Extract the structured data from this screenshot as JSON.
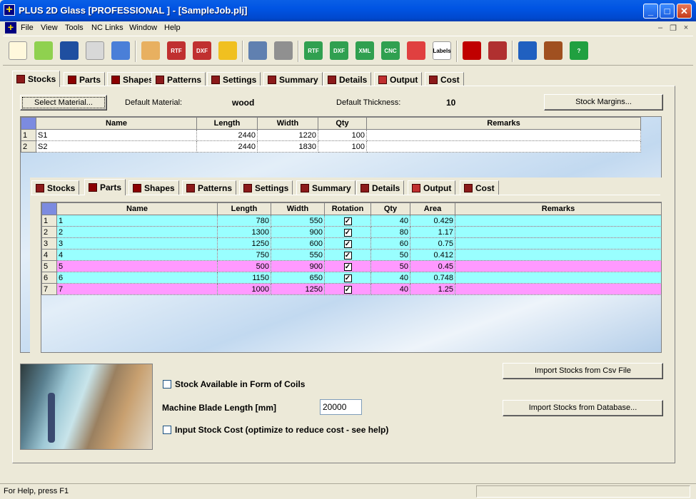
{
  "window": {
    "title": "PLUS 2D Glass [PROFESSIONAL ] - [SampleJob.plj]"
  },
  "menu": [
    "File",
    "View",
    "Tools",
    "NC Links",
    "Window",
    "Help"
  ],
  "toolbar": {
    "buttons": [
      {
        "name": "new-job-icon",
        "label": ""
      },
      {
        "name": "open-job-icon",
        "label": ""
      },
      {
        "name": "save-job-icon",
        "label": ""
      },
      {
        "name": "lock-icon",
        "label": ""
      },
      {
        "name": "checklist-icon",
        "label": ""
      },
      {
        "name": "palette-icon",
        "label": ""
      },
      {
        "name": "rtf-icon",
        "label": "RTF"
      },
      {
        "name": "dxf-icon",
        "label": "DXF"
      },
      {
        "name": "star-icon",
        "label": ""
      },
      {
        "name": "optimize-gear-icon",
        "label": ""
      },
      {
        "name": "refresh-icon",
        "label": ""
      },
      {
        "name": "rtf-export-icon",
        "label": "RTF"
      },
      {
        "name": "dxf-export-icon",
        "label": "DXF"
      },
      {
        "name": "xml-export-icon",
        "label": "XML"
      },
      {
        "name": "cnc-export-icon",
        "label": "CNC"
      },
      {
        "name": "chart-icon",
        "label": ""
      },
      {
        "name": "labels-icon",
        "label": "Labels"
      },
      {
        "name": "layout-icon",
        "label": ""
      },
      {
        "name": "stock-rolls-icon",
        "label": ""
      },
      {
        "name": "info-icon",
        "label": ""
      },
      {
        "name": "film-icon",
        "label": ""
      },
      {
        "name": "help-icon",
        "label": "?"
      }
    ]
  },
  "tabs": [
    "Stocks",
    "Parts",
    "Shapes",
    "Patterns",
    "Settings",
    "Summary",
    "Details",
    "Output",
    "Cost"
  ],
  "stocks_panel": {
    "select_material_label": "Select Material...",
    "default_material_label": "Default Material:",
    "default_material_value": "wood",
    "default_thickness_label": "Default Thickness:",
    "default_thickness_value": "10",
    "stock_margins_label": "Stock Margins...",
    "columns": [
      "Name",
      "Length",
      "Width",
      "Qty",
      "Remarks"
    ],
    "rows": [
      {
        "n": "1",
        "name": "S1",
        "length": "2440",
        "width": "1220",
        "qty": "100",
        "remarks": ""
      },
      {
        "n": "2",
        "name": "S2",
        "length": "2440",
        "width": "1830",
        "qty": "100",
        "remarks": ""
      }
    ]
  },
  "parts_panel": {
    "columns": [
      "Name",
      "Length",
      "Width",
      "Rotation",
      "Qty",
      "Area",
      "Remarks"
    ],
    "rows": [
      {
        "n": "1",
        "name": "1",
        "length": "780",
        "width": "550",
        "rotation": true,
        "qty": "40",
        "area": "0.429",
        "remarks": "",
        "color": "#99FFFF"
      },
      {
        "n": "2",
        "name": "2",
        "length": "1300",
        "width": "900",
        "rotation": true,
        "qty": "80",
        "area": "1.17",
        "remarks": "",
        "color": "#99FFFF"
      },
      {
        "n": "3",
        "name": "3",
        "length": "1250",
        "width": "600",
        "rotation": true,
        "qty": "60",
        "area": "0.75",
        "remarks": "",
        "color": "#99FFFF"
      },
      {
        "n": "4",
        "name": "4",
        "length": "750",
        "width": "550",
        "rotation": true,
        "qty": "50",
        "area": "0.412",
        "remarks": "",
        "color": "#99FFFF"
      },
      {
        "n": "5",
        "name": "5",
        "length": "500",
        "width": "900",
        "rotation": true,
        "qty": "50",
        "area": "0.45",
        "remarks": "",
        "color": "#FF99FF"
      },
      {
        "n": "6",
        "name": "6",
        "length": "1150",
        "width": "650",
        "rotation": true,
        "qty": "40",
        "area": "0.748",
        "remarks": "",
        "color": "#99FFFF"
      },
      {
        "n": "7",
        "name": "7",
        "length": "1000",
        "width": "1250",
        "rotation": true,
        "qty": "40",
        "area": "1.25",
        "remarks": "",
        "color": "#FF99FF"
      }
    ]
  },
  "options": {
    "coils_label": "Stock Available in Form of Coils",
    "blade_label": "Machine Blade Length [mm]",
    "blade_value": "20000",
    "stock_cost_label": "Input Stock Cost (optimize to reduce cost - see help)",
    "import_csv_label": "Import Stocks from Csv File",
    "import_db_label": "Import Stocks from Database..."
  },
  "status": {
    "text": "For Help, press F1"
  },
  "colors": {
    "titlebar": "#0054E3",
    "cyan_row": "#99FFFF",
    "magenta_row": "#FF99FF",
    "corner": "#7C8BE0"
  }
}
